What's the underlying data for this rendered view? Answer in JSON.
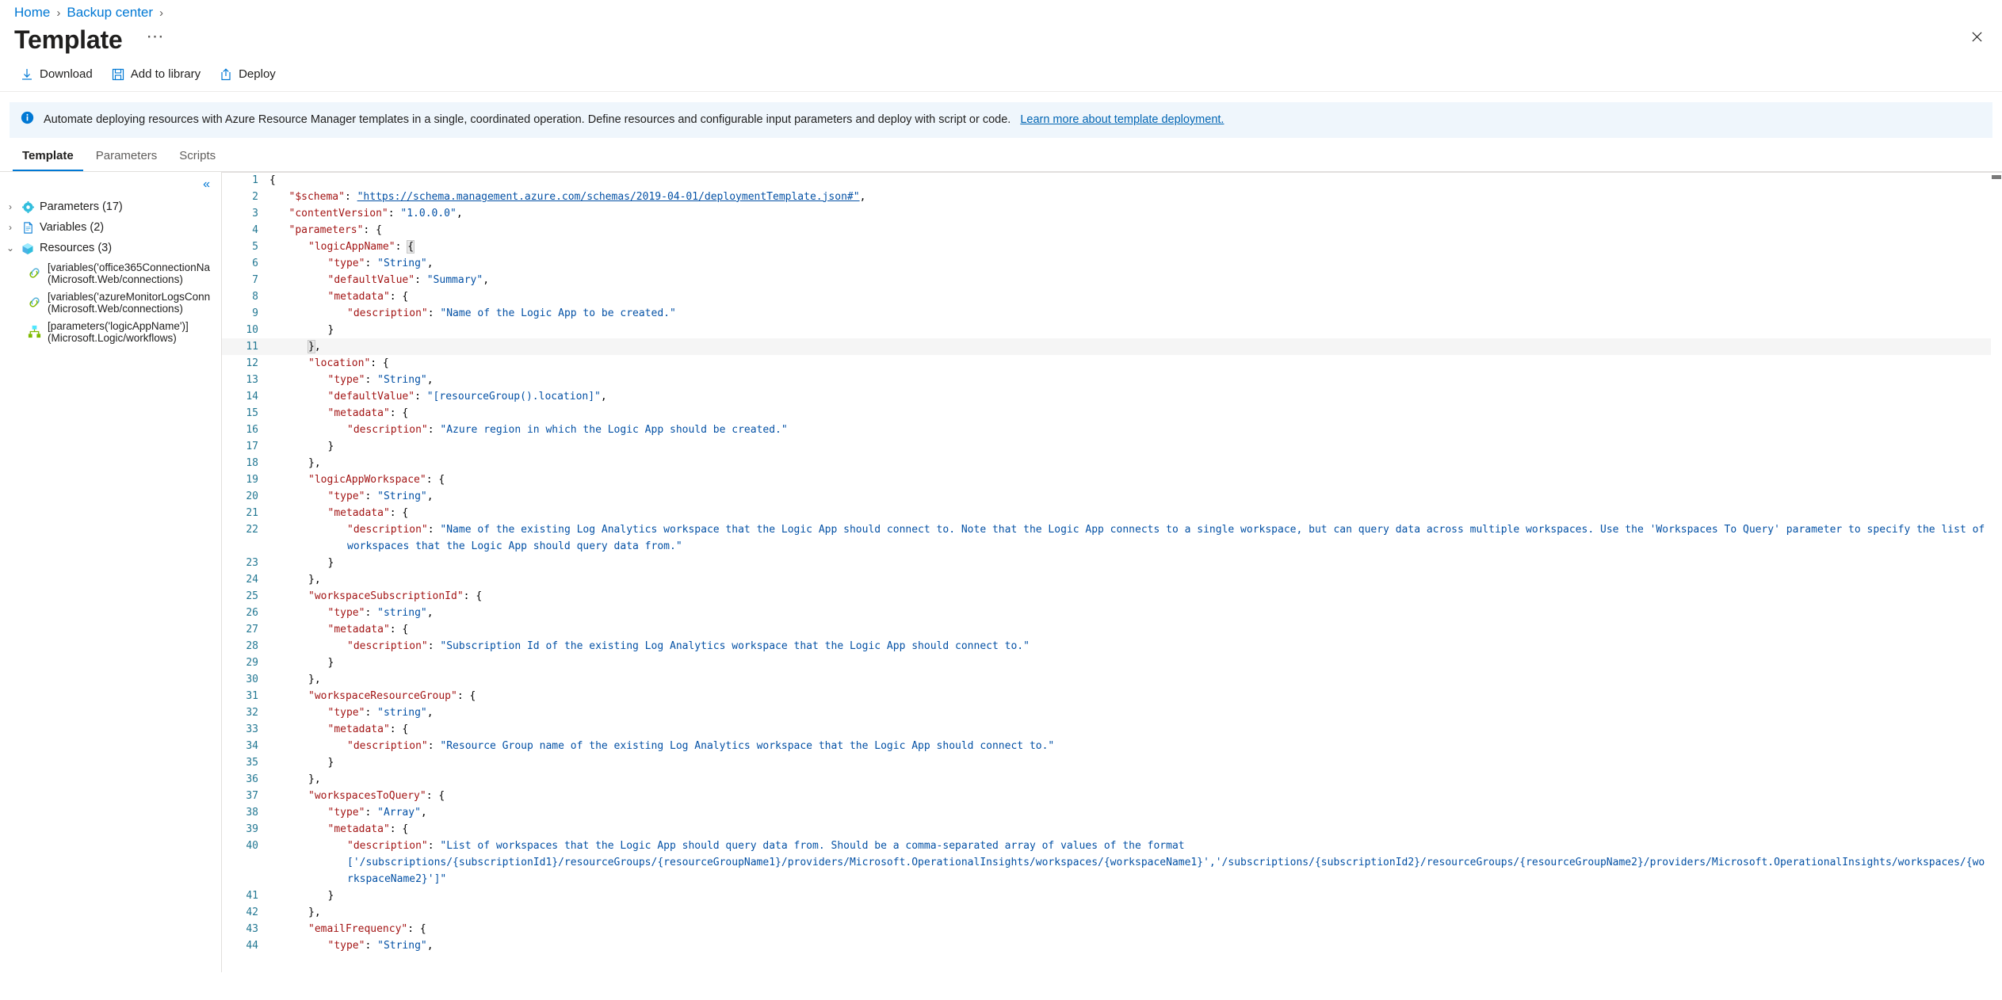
{
  "breadcrumb": {
    "items": [
      {
        "label": "Home"
      },
      {
        "label": "Backup center"
      }
    ],
    "separator": "›"
  },
  "header": {
    "title": "Template",
    "ellipsis": "⋯",
    "close_icon": "close-icon"
  },
  "commandbar": {
    "items": [
      {
        "label": "Download",
        "icon": "download-icon"
      },
      {
        "label": "Add to library",
        "icon": "save-floppy-icon"
      },
      {
        "label": "Deploy",
        "icon": "upload-box-icon"
      }
    ]
  },
  "banner": {
    "icon": "info-icon",
    "text": "Automate deploying resources with Azure Resource Manager templates in a single, coordinated operation. Define resources and configurable input parameters and deploy with script or code. ",
    "link": "Learn more about template deployment."
  },
  "tabs": [
    {
      "label": "Template",
      "active": true
    },
    {
      "label": "Parameters",
      "active": false
    },
    {
      "label": "Scripts",
      "active": false
    }
  ],
  "tree": {
    "collapse_icon": "«",
    "nodes": [
      {
        "chevron": "›",
        "icon": "parameters-gear-icon",
        "label": "Parameters (17)",
        "expanded": false
      },
      {
        "chevron": "›",
        "icon": "variables-document-icon",
        "label": "Variables (2)",
        "expanded": false
      },
      {
        "chevron": "⌄",
        "icon": "resources-cube-icon",
        "label": "Resources (3)",
        "expanded": true
      }
    ],
    "children": [
      {
        "icon": "connection-link-icon",
        "line1": "[variables('office365ConnectionNa",
        "line2": "(Microsoft.Web/connections)"
      },
      {
        "icon": "connection-link-icon",
        "line1": "[variables('azureMonitorLogsConn",
        "line2": "(Microsoft.Web/connections)"
      },
      {
        "icon": "logic-app-icon",
        "line1": "[parameters('logicAppName')]",
        "line2": "(Microsoft.Logic/workflows)"
      }
    ]
  },
  "editor": {
    "language": "json",
    "first_line": 1,
    "last_visible_line": 44,
    "lines": [
      {
        "n": 1,
        "indent": 0,
        "segments": [
          {
            "t": "{",
            "c": "p"
          }
        ]
      },
      {
        "n": 2,
        "indent": 1,
        "segments": [
          {
            "t": "\"$schema\"",
            "c": "k"
          },
          {
            "t": ": ",
            "c": "p"
          },
          {
            "t": "\"https://schema.management.azure.com/schemas/2019-04-01/deploymentTemplate.json#\"",
            "c": "url"
          },
          {
            "t": ",",
            "c": "p"
          }
        ]
      },
      {
        "n": 3,
        "indent": 1,
        "segments": [
          {
            "t": "\"contentVersion\"",
            "c": "k"
          },
          {
            "t": ": ",
            "c": "p"
          },
          {
            "t": "\"1.0.0.0\"",
            "c": "s"
          },
          {
            "t": ",",
            "c": "p"
          }
        ]
      },
      {
        "n": 4,
        "indent": 1,
        "segments": [
          {
            "t": "\"parameters\"",
            "c": "k"
          },
          {
            "t": ": {",
            "c": "p"
          }
        ]
      },
      {
        "n": 5,
        "indent": 2,
        "segments": [
          {
            "t": "\"logicAppName\"",
            "c": "k"
          },
          {
            "t": ": ",
            "c": "p"
          },
          {
            "t": "{",
            "c": "brk"
          }
        ]
      },
      {
        "n": 6,
        "indent": 3,
        "segments": [
          {
            "t": "\"type\"",
            "c": "k"
          },
          {
            "t": ": ",
            "c": "p"
          },
          {
            "t": "\"String\"",
            "c": "s"
          },
          {
            "t": ",",
            "c": "p"
          }
        ]
      },
      {
        "n": 7,
        "indent": 3,
        "segments": [
          {
            "t": "\"defaultValue\"",
            "c": "k"
          },
          {
            "t": ": ",
            "c": "p"
          },
          {
            "t": "\"Summary\"",
            "c": "s"
          },
          {
            "t": ",",
            "c": "p"
          }
        ]
      },
      {
        "n": 8,
        "indent": 3,
        "segments": [
          {
            "t": "\"metadata\"",
            "c": "k"
          },
          {
            "t": ": {",
            "c": "p"
          }
        ]
      },
      {
        "n": 9,
        "indent": 4,
        "segments": [
          {
            "t": "\"description\"",
            "c": "k"
          },
          {
            "t": ": ",
            "c": "p"
          },
          {
            "t": "\"Name of the Logic App to be created.\"",
            "c": "s"
          }
        ]
      },
      {
        "n": 10,
        "indent": 3,
        "segments": [
          {
            "t": "}",
            "c": "p"
          }
        ]
      },
      {
        "n": 11,
        "indent": 2,
        "segments": [
          {
            "t": "}",
            "c": "brk"
          },
          {
            "t": ",",
            "c": "p"
          }
        ],
        "current": true
      },
      {
        "n": 12,
        "indent": 2,
        "segments": [
          {
            "t": "\"location\"",
            "c": "k"
          },
          {
            "t": ": {",
            "c": "p"
          }
        ]
      },
      {
        "n": 13,
        "indent": 3,
        "segments": [
          {
            "t": "\"type\"",
            "c": "k"
          },
          {
            "t": ": ",
            "c": "p"
          },
          {
            "t": "\"String\"",
            "c": "s"
          },
          {
            "t": ",",
            "c": "p"
          }
        ]
      },
      {
        "n": 14,
        "indent": 3,
        "segments": [
          {
            "t": "\"defaultValue\"",
            "c": "k"
          },
          {
            "t": ": ",
            "c": "p"
          },
          {
            "t": "\"[resourceGroup().location]\"",
            "c": "s"
          },
          {
            "t": ",",
            "c": "p"
          }
        ]
      },
      {
        "n": 15,
        "indent": 3,
        "segments": [
          {
            "t": "\"metadata\"",
            "c": "k"
          },
          {
            "t": ": {",
            "c": "p"
          }
        ]
      },
      {
        "n": 16,
        "indent": 4,
        "segments": [
          {
            "t": "\"description\"",
            "c": "k"
          },
          {
            "t": ": ",
            "c": "p"
          },
          {
            "t": "\"Azure region in which the Logic App should be created.\"",
            "c": "s"
          }
        ]
      },
      {
        "n": 17,
        "indent": 3,
        "segments": [
          {
            "t": "}",
            "c": "p"
          }
        ]
      },
      {
        "n": 18,
        "indent": 2,
        "segments": [
          {
            "t": "},",
            "c": "p"
          }
        ]
      },
      {
        "n": 19,
        "indent": 2,
        "segments": [
          {
            "t": "\"logicAppWorkspace\"",
            "c": "k"
          },
          {
            "t": ": {",
            "c": "p"
          }
        ]
      },
      {
        "n": 20,
        "indent": 3,
        "segments": [
          {
            "t": "\"type\"",
            "c": "k"
          },
          {
            "t": ": ",
            "c": "p"
          },
          {
            "t": "\"String\"",
            "c": "s"
          },
          {
            "t": ",",
            "c": "p"
          }
        ]
      },
      {
        "n": 21,
        "indent": 3,
        "segments": [
          {
            "t": "\"metadata\"",
            "c": "k"
          },
          {
            "t": ": {",
            "c": "p"
          }
        ]
      },
      {
        "n": 22,
        "indent": 4,
        "segments": [
          {
            "t": "\"description\"",
            "c": "k"
          },
          {
            "t": ": ",
            "c": "p"
          },
          {
            "t": "\"Name of the existing Log Analytics workspace that the Logic App should connect to. Note that the Logic App connects to a single workspace, but can query data across multiple workspaces. Use the 'Workspaces To Query' parameter to specify the list of workspaces that the Logic App should query data from.\"",
            "c": "s"
          }
        ]
      },
      {
        "n": 23,
        "indent": 3,
        "segments": [
          {
            "t": "}",
            "c": "p"
          }
        ]
      },
      {
        "n": 24,
        "indent": 2,
        "segments": [
          {
            "t": "},",
            "c": "p"
          }
        ]
      },
      {
        "n": 25,
        "indent": 2,
        "segments": [
          {
            "t": "\"workspaceSubscriptionId\"",
            "c": "k"
          },
          {
            "t": ": {",
            "c": "p"
          }
        ]
      },
      {
        "n": 26,
        "indent": 3,
        "segments": [
          {
            "t": "\"type\"",
            "c": "k"
          },
          {
            "t": ": ",
            "c": "p"
          },
          {
            "t": "\"string\"",
            "c": "s"
          },
          {
            "t": ",",
            "c": "p"
          }
        ]
      },
      {
        "n": 27,
        "indent": 3,
        "segments": [
          {
            "t": "\"metadata\"",
            "c": "k"
          },
          {
            "t": ": {",
            "c": "p"
          }
        ]
      },
      {
        "n": 28,
        "indent": 4,
        "segments": [
          {
            "t": "\"description\"",
            "c": "k"
          },
          {
            "t": ": ",
            "c": "p"
          },
          {
            "t": "\"Subscription Id of the existing Log Analytics workspace that the Logic App should connect to.\"",
            "c": "s"
          }
        ]
      },
      {
        "n": 29,
        "indent": 3,
        "segments": [
          {
            "t": "}",
            "c": "p"
          }
        ]
      },
      {
        "n": 30,
        "indent": 2,
        "segments": [
          {
            "t": "},",
            "c": "p"
          }
        ]
      },
      {
        "n": 31,
        "indent": 2,
        "segments": [
          {
            "t": "\"workspaceResourceGroup\"",
            "c": "k"
          },
          {
            "t": ": {",
            "c": "p"
          }
        ]
      },
      {
        "n": 32,
        "indent": 3,
        "segments": [
          {
            "t": "\"type\"",
            "c": "k"
          },
          {
            "t": ": ",
            "c": "p"
          },
          {
            "t": "\"string\"",
            "c": "s"
          },
          {
            "t": ",",
            "c": "p"
          }
        ]
      },
      {
        "n": 33,
        "indent": 3,
        "segments": [
          {
            "t": "\"metadata\"",
            "c": "k"
          },
          {
            "t": ": {",
            "c": "p"
          }
        ]
      },
      {
        "n": 34,
        "indent": 4,
        "segments": [
          {
            "t": "\"description\"",
            "c": "k"
          },
          {
            "t": ": ",
            "c": "p"
          },
          {
            "t": "\"Resource Group name of the existing Log Analytics workspace that the Logic App should connect to.\"",
            "c": "s"
          }
        ]
      },
      {
        "n": 35,
        "indent": 3,
        "segments": [
          {
            "t": "}",
            "c": "p"
          }
        ]
      },
      {
        "n": 36,
        "indent": 2,
        "segments": [
          {
            "t": "},",
            "c": "p"
          }
        ]
      },
      {
        "n": 37,
        "indent": 2,
        "segments": [
          {
            "t": "\"workspacesToQuery\"",
            "c": "k"
          },
          {
            "t": ": {",
            "c": "p"
          }
        ]
      },
      {
        "n": 38,
        "indent": 3,
        "segments": [
          {
            "t": "\"type\"",
            "c": "k"
          },
          {
            "t": ": ",
            "c": "p"
          },
          {
            "t": "\"Array\"",
            "c": "s"
          },
          {
            "t": ",",
            "c": "p"
          }
        ]
      },
      {
        "n": 39,
        "indent": 3,
        "segments": [
          {
            "t": "\"metadata\"",
            "c": "k"
          },
          {
            "t": ": {",
            "c": "p"
          }
        ]
      },
      {
        "n": 40,
        "indent": 4,
        "segments": [
          {
            "t": "\"description\"",
            "c": "k"
          },
          {
            "t": ": ",
            "c": "p"
          },
          {
            "t": "\"List of workspaces that the Logic App should query data from. Should be a comma-separated array of values of the format ['/subscriptions/{subscriptionId1}/resourceGroups/{resourceGroupName1}/providers/Microsoft.OperationalInsights/workspaces/{workspaceName1}','/subscriptions/{subscriptionId2}/resourceGroups/{resourceGroupName2}/providers/Microsoft.OperationalInsights/workspaces/{workspaceName2}']\"",
            "c": "s"
          }
        ]
      },
      {
        "n": 41,
        "indent": 3,
        "segments": [
          {
            "t": "}",
            "c": "p"
          }
        ]
      },
      {
        "n": 42,
        "indent": 2,
        "segments": [
          {
            "t": "},",
            "c": "p"
          }
        ]
      },
      {
        "n": 43,
        "indent": 2,
        "segments": [
          {
            "t": "\"emailFrequency\"",
            "c": "k"
          },
          {
            "t": ": {",
            "c": "p"
          }
        ]
      },
      {
        "n": 44,
        "indent": 3,
        "segments": [
          {
            "t": "\"type\"",
            "c": "k"
          },
          {
            "t": ": ",
            "c": "p"
          },
          {
            "t": "\"String\"",
            "c": "s"
          },
          {
            "t": ",",
            "c": "p"
          }
        ]
      }
    ]
  },
  "colors": {
    "accent": "#0078d4",
    "link": "#0065b3",
    "banner_bg": "#eff6fc",
    "key": "#a31515",
    "string": "#0451a5",
    "linenum": "#237893",
    "text": "#201f1e"
  }
}
